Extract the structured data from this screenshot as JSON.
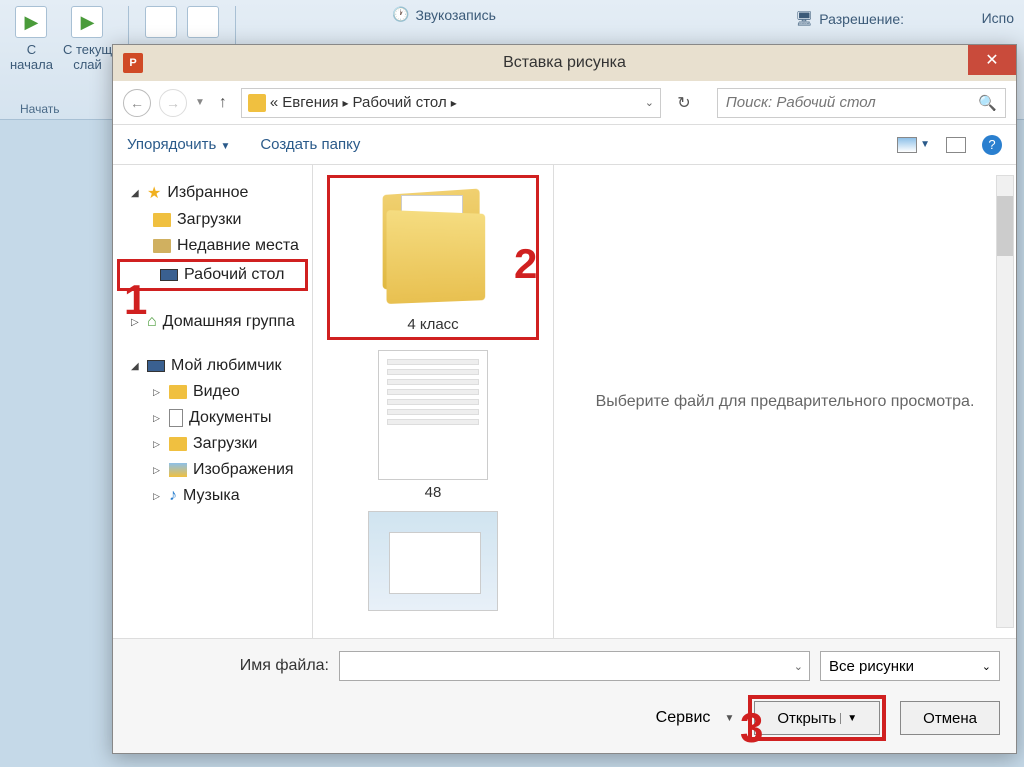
{
  "ribbon": {
    "from_beginning": "С\nначала",
    "from_current": "С текущ\nслай",
    "group_start": "Начать",
    "sound_recording": "Звукозапись",
    "resolution": "Разрешение:",
    "use": "Испо"
  },
  "dialog": {
    "title": "Вставка рисунка",
    "breadcrumb_sep": "«",
    "breadcrumb_user": "Евгения",
    "breadcrumb_folder": "Рабочий стол",
    "search_placeholder": "Поиск: Рабочий стол",
    "organize": "Упорядочить",
    "new_folder": "Создать папку"
  },
  "sidebar": {
    "favorites": "Избранное",
    "downloads": "Загрузки",
    "recent": "Недавние места",
    "desktop": "Рабочий стол",
    "homegroup": "Домашняя группа",
    "mypc": "Мой любимчик",
    "video": "Видео",
    "documents": "Документы",
    "downloads2": "Загрузки",
    "images": "Изображения",
    "music": "Музыка"
  },
  "files": {
    "folder1": "4 класс",
    "file2": "48"
  },
  "preview": {
    "text": "Выберите файл для предварительного просмотра."
  },
  "footer": {
    "filename_label": "Имя файла:",
    "filter": "Все рисунки",
    "tools": "Сервис",
    "open": "Открыть",
    "cancel": "Отмена"
  },
  "annotations": {
    "one": "1",
    "two": "2",
    "three": "3"
  }
}
